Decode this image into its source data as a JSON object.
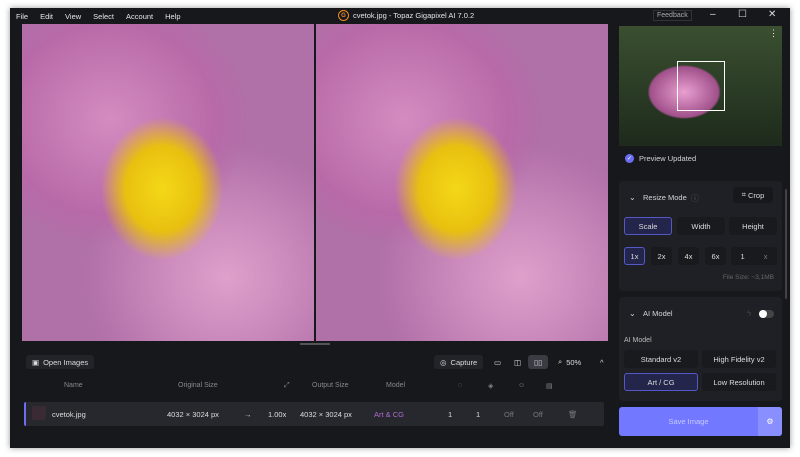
{
  "menu": [
    "File",
    "Edit",
    "View",
    "Select",
    "Account",
    "Help"
  ],
  "title": "cvetok.jpg - Topaz Gigapixel AI 7.0.2",
  "logo_letter": "G",
  "feedback": "Feedback",
  "toolbar": {
    "open_images": "Open Images",
    "capture": "Capture",
    "zoom": "50%"
  },
  "table": {
    "headers": {
      "name": "Name",
      "original": "Original Size",
      "output": "Output Size",
      "model": "Model"
    },
    "rows": [
      {
        "name": "cvetok.jpg",
        "original": "4032 × 3024 px",
        "scale": "1.00x",
        "output": "4032 × 3024 px",
        "model": "Art & CG",
        "c1": "1",
        "c2": "1",
        "c3": "Off",
        "c4": "Off"
      }
    ]
  },
  "panel": {
    "preview_status": "Preview Updated",
    "resize_mode": "Resize Mode",
    "crop": "Crop",
    "modes": [
      "Scale",
      "Width",
      "Height"
    ],
    "scales": [
      "1x",
      "2x",
      "4x",
      "6x"
    ],
    "custom_scale": "1",
    "custom_suffix": "x",
    "file_size": "File Size: ~3,1MB",
    "ai_model_title": "AI Model",
    "ai_model_label": "AI Model",
    "models": [
      "Standard v2",
      "High Fidelity v2",
      "Art / CG",
      "Low Resolution"
    ],
    "save": "Save Image"
  },
  "colors": {
    "accent": "#7278ff",
    "model_text": "#b06ad0"
  }
}
